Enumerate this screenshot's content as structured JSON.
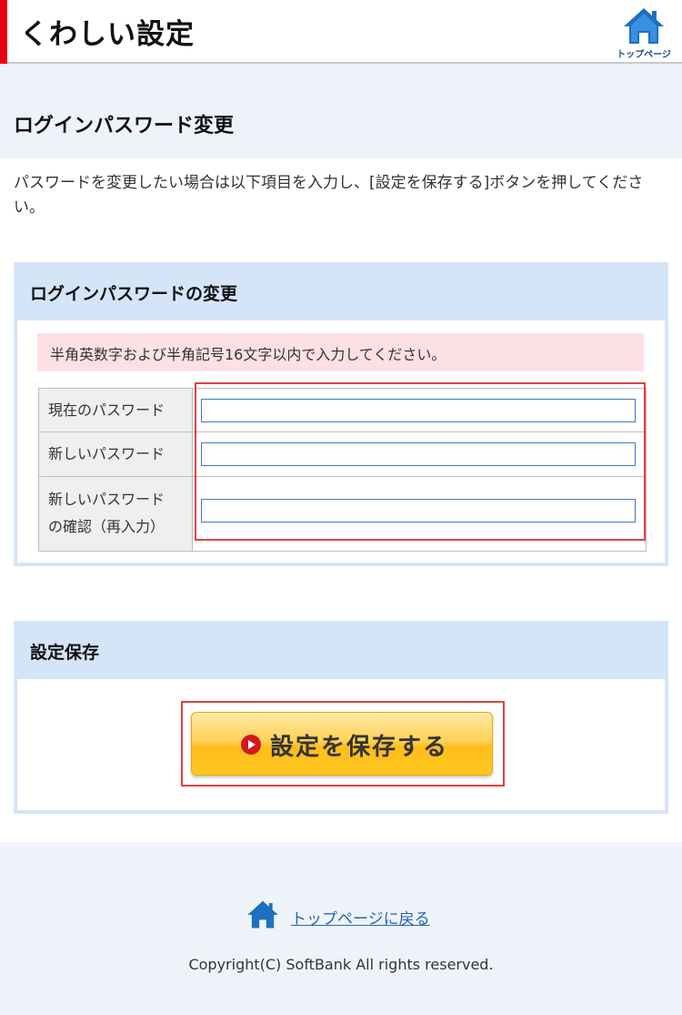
{
  "header": {
    "title": "くわしい設定",
    "home_label": "トップページ",
    "accent_color": "#e60012"
  },
  "page": {
    "heading": "ログインパスワード変更",
    "description": "パスワードを変更したい場合は以下項目を入力し、[設定を保存する]ボタンを押してください。"
  },
  "password_section": {
    "title": "ログインパスワードの変更",
    "notice": "半角英数字および半角記号16文字以内で入力してください。",
    "fields": [
      {
        "label": "現在のパスワード",
        "value": ""
      },
      {
        "label": "新しいパスワード",
        "value": ""
      },
      {
        "label_line1": "新しいパスワード",
        "label_line2": "の確認（再入力）",
        "value": ""
      }
    ]
  },
  "save_section": {
    "title": "設定保存",
    "button_label": "設定を保存する"
  },
  "footer": {
    "back_link": "トップページに戻る",
    "copyright": "Copyright(C) SoftBank All rights reserved."
  }
}
